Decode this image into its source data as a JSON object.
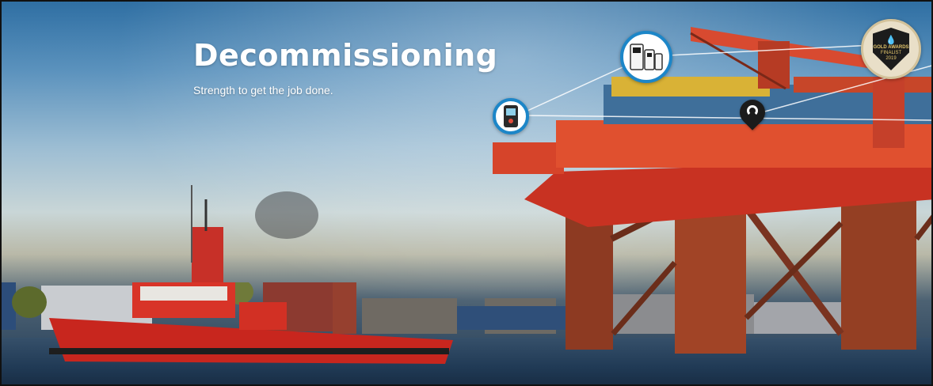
{
  "hero": {
    "title": "Decommissioning",
    "subtitle": "Strength to get the job done."
  },
  "hotspots": [
    {
      "name": "portable-gas-detector-icon"
    },
    {
      "name": "gas-detector-family-icon"
    },
    {
      "name": "location-pin-icon"
    }
  ],
  "badge": {
    "award_line1": "GOLD AWARDS",
    "award_line2": "FINALIST",
    "award_year": "2019"
  },
  "colors": {
    "hotspot_ring": "#1c86c8",
    "rig_red": "#d83a26",
    "boat_red": "#c8261e",
    "sky_top": "#2f6fa3"
  }
}
